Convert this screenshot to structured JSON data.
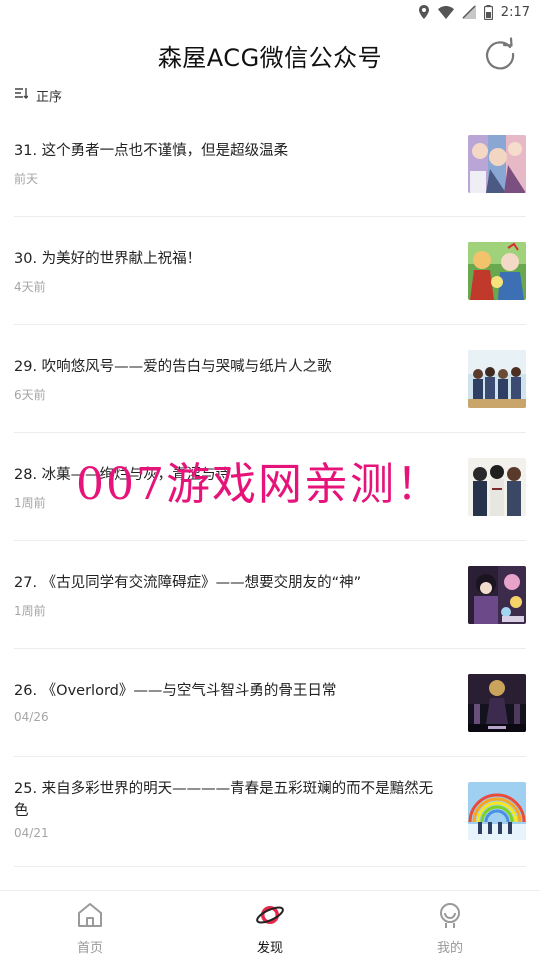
{
  "status_bar": {
    "time": "2:17"
  },
  "header": {
    "title": "森屋ACG微信公众号",
    "refresh_icon": "refresh-icon"
  },
  "sort": {
    "label": "正序",
    "icon": "sort-icon"
  },
  "articles": [
    {
      "title": "31. 这个勇者一点也不谨慎，但是超级温柔",
      "time": "前天"
    },
    {
      "title": "30. 为美好的世界献上祝福！",
      "time": "4天前"
    },
    {
      "title": "29. 吹响悠风号——爱的告白与哭喊与纸片人之歌",
      "time": "6天前"
    },
    {
      "title": "28. 冰菓——绚烂与灰，青涩与诗",
      "time": "1周前"
    },
    {
      "title": "27. 《古见同学有交流障碍症》——想要交朋友的“神”",
      "time": "1周前"
    },
    {
      "title": "26. 《Overlord》——与空气斗智斗勇的骨王日常",
      "time": "04/26"
    },
    {
      "title": "25. 来自多彩世界的明天————青春是五彩斑斓的而不是黯然无色",
      "time": "04/21"
    }
  ],
  "watermark": "007游戏网亲测！",
  "nav": [
    {
      "label": "首页",
      "icon": "home-icon",
      "active": false
    },
    {
      "label": "发现",
      "icon": "planet-icon",
      "active": true
    },
    {
      "label": "我的",
      "icon": "profile-icon",
      "active": false
    }
  ],
  "colors": {
    "accent": "#e6294a",
    "watermark": "#e6147a",
    "muted": "#a5a5a5"
  }
}
